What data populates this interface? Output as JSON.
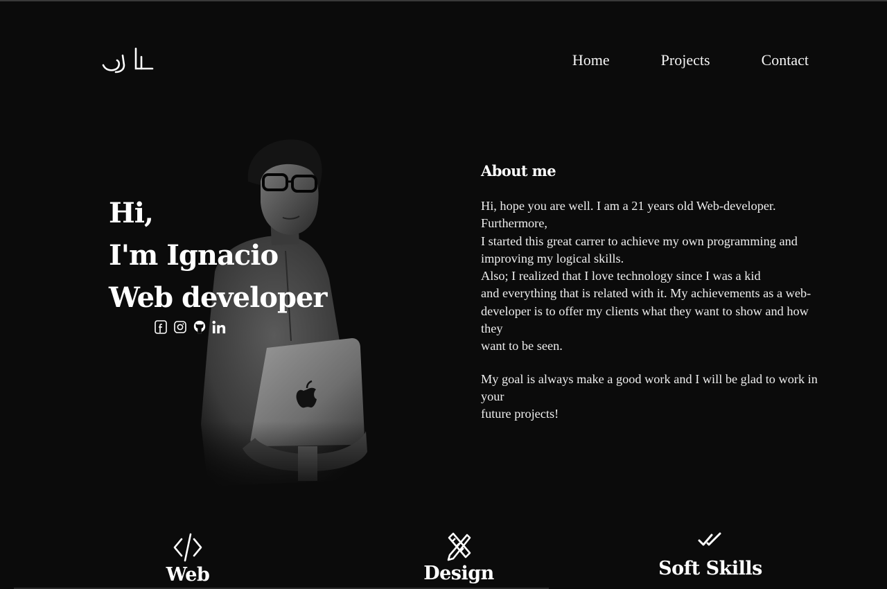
{
  "nav": {
    "items": [
      {
        "label": "Home"
      },
      {
        "label": "Projects"
      },
      {
        "label": "Contact"
      }
    ]
  },
  "hero": {
    "greeting": "Hi,",
    "name_line": "I'm Ignacio",
    "role": "Web developer",
    "socials": [
      "facebook-icon",
      "instagram-icon",
      "github-icon",
      "linkedin-icon"
    ]
  },
  "about": {
    "heading": "About me",
    "lines": [
      "Hi, hope you are well. I am a 21 years old Web-developer. Furthermore,",
      "I started this great carrer to achieve my own programming and",
      "improving my logical skills.",
      "Also; I realized that I love technology since I was a kid",
      "and everything that is related with it. My achievements as a web-",
      "developer is to offer my clients what they want to show and how they",
      "want to be seen."
    ],
    "goal_lines": [
      "My goal is always make a good work and I will be glad to work in your",
      "future projects!"
    ]
  },
  "skills": [
    {
      "title": "Web",
      "icon": "code-icon"
    },
    {
      "title": "Design",
      "icon": "design-tools-icon"
    },
    {
      "title": "Soft Skills",
      "icon": "double-check-icon"
    }
  ],
  "colors": {
    "background": "#0b0b0b",
    "text": "#ffffff"
  }
}
